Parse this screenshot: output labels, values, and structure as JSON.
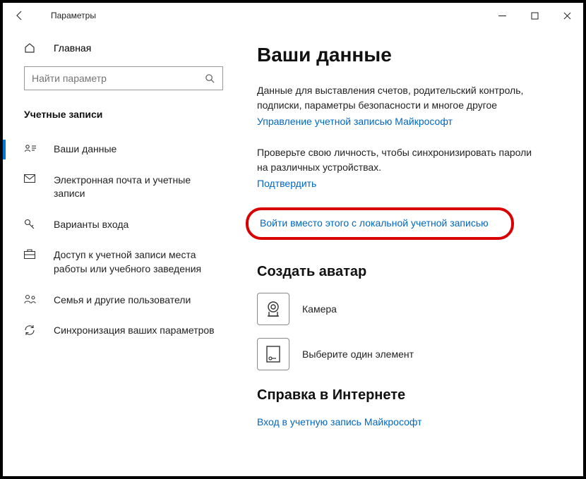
{
  "titlebar": {
    "title": "Параметры"
  },
  "sidebar": {
    "home": "Главная",
    "search_placeholder": "Найти параметр",
    "section": "Учетные записи",
    "items": [
      {
        "label": "Ваши данные"
      },
      {
        "label": "Электронная почта и учетные записи"
      },
      {
        "label": "Варианты входа"
      },
      {
        "label": "Доступ к учетной записи места работы или учебного заведения"
      },
      {
        "label": "Семья и другие пользователи"
      },
      {
        "label": "Синхронизация ваших параметров"
      }
    ]
  },
  "main": {
    "heading": "Ваши данные",
    "billing_text": "Данные для выставления счетов, родительский контроль, подписки, параметры безопасности и многое другое",
    "manage_link": "Управление учетной записью Майкрософт",
    "verify_text": "Проверьте свою личность, чтобы синхронизировать пароли на различных устройствах.",
    "verify_link": "Подтвердить",
    "local_account_link": "Войти вместо этого с локальной учетной записью",
    "avatar_heading": "Создать аватар",
    "camera_label": "Камера",
    "browse_label": "Выберите один элемент",
    "help_heading": "Справка в Интернете",
    "help_link": "Вход в учетную запись Майкрософт"
  }
}
